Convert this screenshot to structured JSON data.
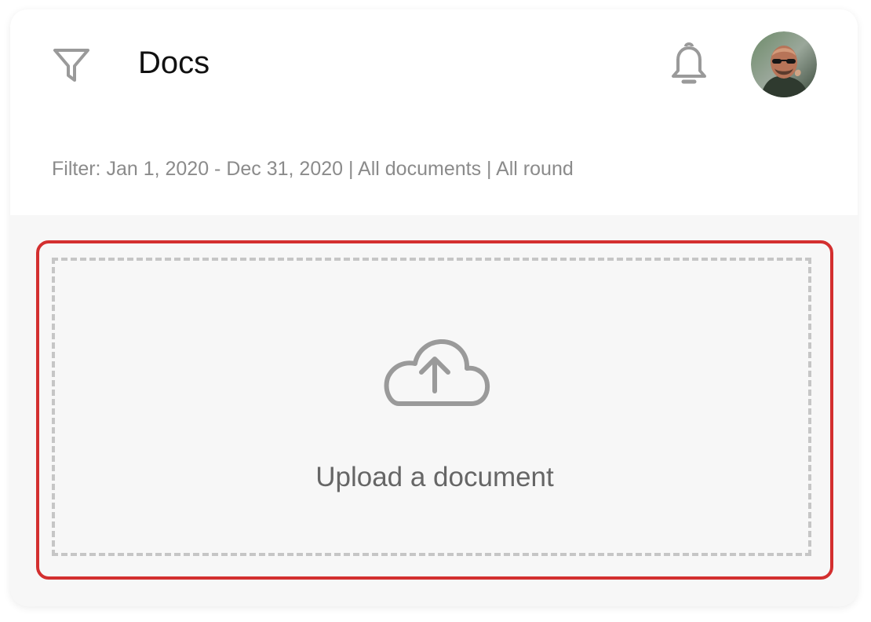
{
  "header": {
    "title": "Docs",
    "filter_summary": "Filter: Jan 1, 2020 - Dec 31, 2020 | All documents | All round",
    "icons": {
      "filter": "filter-icon",
      "notifications": "bell-icon",
      "avatar": "user-avatar"
    }
  },
  "upload": {
    "label": "Upload a document",
    "icon": "cloud-upload-icon"
  },
  "colors": {
    "accent_border": "#d32f2f",
    "dashed_border": "#c6c6c6",
    "icon_gray": "#9a9a9a",
    "muted_text": "#8b8b8b",
    "panel_bg": "#f7f7f7"
  }
}
